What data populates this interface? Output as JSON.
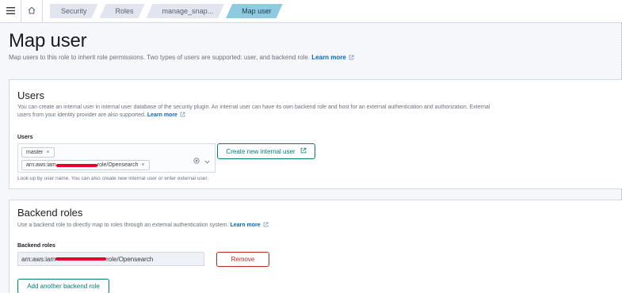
{
  "icons": {
    "menu": "hamburger-icon",
    "home": "home-icon",
    "external": "external-link-icon",
    "clear": "clear-icon",
    "dropdown": "chevron-down-icon"
  },
  "colors": {
    "accent": "#017d73",
    "link": "#006bb8",
    "danger": "#bd271e",
    "active_crumb": "#8ecbe0"
  },
  "breadcrumbs": [
    "Security",
    "Roles",
    "manage_snap...",
    "Map user"
  ],
  "header": {
    "title": "Map user",
    "description": "Map users to this role to inherit role permissions. Two types of users are supported: user, and backend role.",
    "learn_more": "Learn more"
  },
  "users": {
    "title": "Users",
    "description_line1": "You can create an internal user in internal user database of the security plugin. An internal user can have its own backend role and host for an external authentication and authorization. External",
    "description_line2": "users from your identity provider are also supported.",
    "learn_more": "Learn more",
    "field_label": "Users",
    "chips": [
      {
        "prefix": "master",
        "suffix": ""
      },
      {
        "prefix": "arn:aws:iam",
        "suffix": "role/Opensearch"
      }
    ],
    "create_button": "Create new internal user",
    "help_text": "Look up by user name. You can also create new internal user or enter external user."
  },
  "backend_roles": {
    "title": "Backend roles",
    "description": "Use a backend role to directly map to roles through an external authentication system.",
    "learn_more": "Learn more",
    "field_label": "Backend roles",
    "value_prefix": "arn:aws:iam",
    "value_suffix": "role/Opensearch",
    "remove_button": "Remove",
    "add_button": "Add another backend role"
  }
}
